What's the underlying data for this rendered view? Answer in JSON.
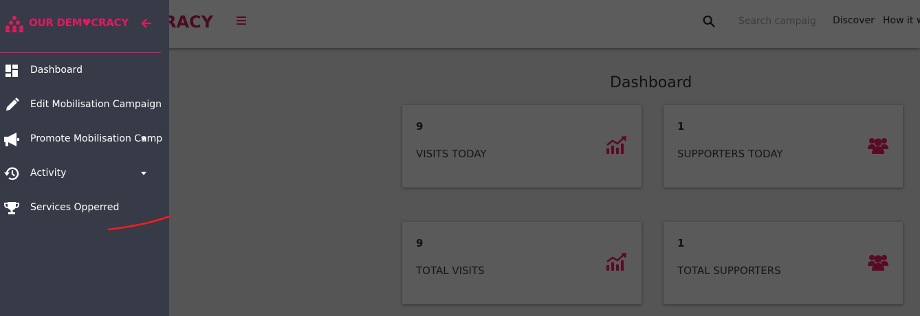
{
  "topbar": {
    "brand_behind": "RACY",
    "search_placeholder": "Search campaig",
    "nav": [
      "Discover",
      "How it w"
    ]
  },
  "sidebar": {
    "logo_text": "OUR DEM♥CRACY",
    "items": [
      {
        "label": "Dashboard",
        "icon": "dashboard-icon"
      },
      {
        "label": "Edit Mobilisation Campaign",
        "icon": "pencil-icon"
      },
      {
        "label": "Promote Mobilisation Camp",
        "icon": "megaphone-icon"
      },
      {
        "label": "Activity",
        "icon": "history-icon"
      },
      {
        "label": "Services Opperred",
        "icon": "trophy-icon"
      }
    ]
  },
  "main": {
    "title": "Dashboard",
    "cards": [
      {
        "value": "9",
        "label": "VISITS TODAY",
        "icon": "trending-up-icon"
      },
      {
        "value": "1",
        "label": "SUPPORTERS TODAY",
        "icon": "users-icon"
      },
      {
        "value": "9",
        "label": "TOTAL VISITS",
        "icon": "trending-up-icon"
      },
      {
        "value": "1",
        "label": "TOTAL SUPPORTERS",
        "icon": "users-icon"
      }
    ]
  },
  "colors": {
    "accent": "#e3195e",
    "icon_dark": "#5a0a24",
    "sidebar_bg": "#363b47",
    "overlay_bg": "#555555"
  }
}
